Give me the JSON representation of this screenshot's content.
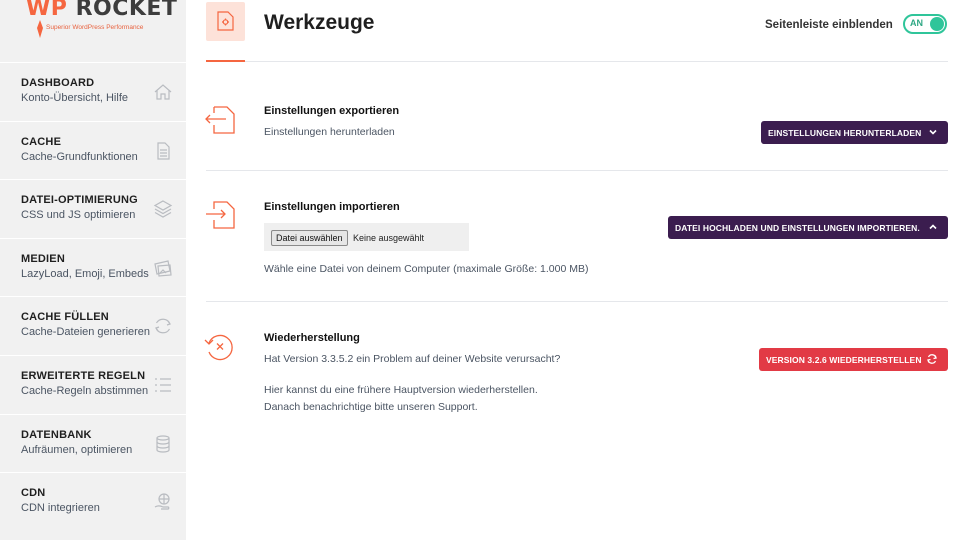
{
  "brand": {
    "logo_prefix": "WP",
    "logo_main": "ROCKET",
    "tagline": "Superior WordPress Performance",
    "accent_color": "#f56640"
  },
  "sidebar": {
    "items": [
      {
        "title": "DASHBOARD",
        "subtitle": "Konto-Übersicht, Hilfe",
        "icon": "home-icon"
      },
      {
        "title": "CACHE",
        "subtitle": "Cache-Grundfunktionen",
        "icon": "document-icon"
      },
      {
        "title": "DATEI-OPTIMIERUNG",
        "subtitle": "CSS und JS optimieren",
        "icon": "layers-icon"
      },
      {
        "title": "MEDIEN",
        "subtitle": "LazyLoad, Emoji, Embeds",
        "icon": "images-icon"
      },
      {
        "title": "CACHE FÜLLEN",
        "subtitle": "Cache-Dateien generieren",
        "icon": "refresh-icon"
      },
      {
        "title": "ERWEITERTE REGELN",
        "subtitle": "Cache-Regeln abstimmen",
        "icon": "list-icon"
      },
      {
        "title": "DATENBANK",
        "subtitle": "Aufräumen, optimieren",
        "icon": "database-icon"
      },
      {
        "title": "CDN",
        "subtitle": "CDN integrieren",
        "icon": "globe-hand-icon"
      }
    ]
  },
  "header": {
    "title": "Werkzeuge",
    "icon": "tools-document-icon",
    "sidebar_toggle_label": "Seitenleiste einblenden",
    "sidebar_toggle_state": "AN",
    "toggle_color": "#2fc59a"
  },
  "export": {
    "title": "Einstellungen exportieren",
    "description": "Einstellungen herunterladen",
    "button_label": "EINSTELLUNGEN HERUNTERLADEN",
    "icon": "export-icon"
  },
  "import": {
    "title": "Einstellungen importieren",
    "file_button": "Datei auswählen",
    "file_status": "Keine ausgewählt",
    "hint": "Wähle eine Datei von deinem Computer (maximale Größe: 1.000 MB)",
    "button_label": "DATEI HOCHLADEN UND EINSTELLUNGEN IMPORTIEREN.",
    "icon": "import-icon"
  },
  "rollback": {
    "title": "Wiederherstellung",
    "question": "Hat Version 3.3.5.2 ein Problem auf deiner Website verursacht?",
    "line1": "Hier kannst du eine frühere Hauptversion wiederherstellen.",
    "line2": "Danach benachrichtige bitte unseren Support.",
    "button_label": "VERSION 3.2.6 WIEDERHERSTELLEN",
    "icon": "rollback-icon"
  },
  "colors": {
    "primary_button": "#3b1d4f",
    "danger_button": "#e23a45"
  }
}
